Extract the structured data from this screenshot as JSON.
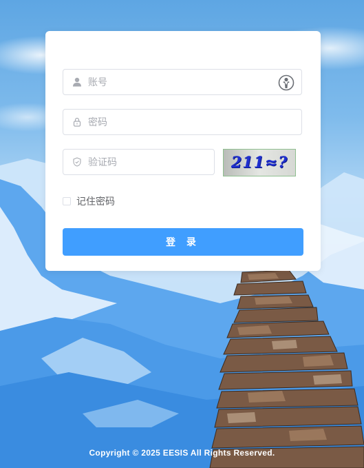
{
  "login": {
    "account_placeholder": "账号",
    "password_placeholder": "密码",
    "captcha_placeholder": "验证码",
    "captcha_text": "211≈?",
    "remember_label": "记住密码",
    "remember_checked": false,
    "submit_label": "登 录"
  },
  "footer": {
    "copyright": "Copyright © 2025 EESIS All Rights Reserved."
  },
  "colors": {
    "primary": "#409eff",
    "captcha_text": "#1f2fd0",
    "input_border": "#dcdfe6"
  },
  "icons": {
    "account": "user-icon",
    "account_suffix": "user-circle-icon",
    "password": "lock-icon",
    "captcha": "shield-icon"
  }
}
